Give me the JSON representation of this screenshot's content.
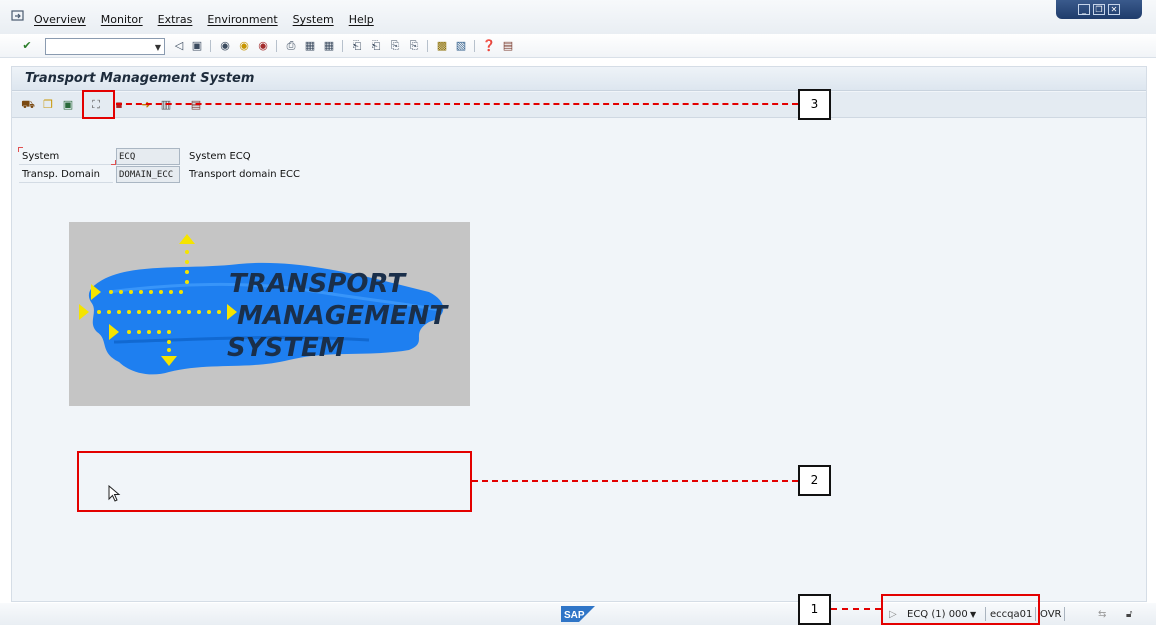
{
  "menubar": {
    "items": [
      "Overview",
      "Monitor",
      "Extras",
      "Environment",
      "System",
      "Help"
    ]
  },
  "toolbar": {
    "command_field_value": ""
  },
  "screen": {
    "title": "Transport Management System"
  },
  "fields": [
    {
      "label": "System",
      "value": "ECQ",
      "description": "System ECQ"
    },
    {
      "label": "Transp. Domain",
      "value": "DOMAIN_ECC",
      "description": "Transport domain ECC"
    }
  ],
  "logo": {
    "text_lines": [
      "TRANSPORT",
      "MANAGEMENT",
      "SYSTEM"
    ],
    "colors": {
      "brush": "#1e7ff0",
      "arrows": "#f5e400",
      "lettering": "#1a2f4a",
      "background": "#c5c5c5"
    }
  },
  "statusbar": {
    "system": "ECQ (1) 000",
    "server": "eccqa01",
    "mode": "OVR",
    "sap_logo": "SAP"
  },
  "annotations": {
    "callouts": [
      "1",
      "2",
      "3"
    ],
    "color": "#e30000"
  }
}
